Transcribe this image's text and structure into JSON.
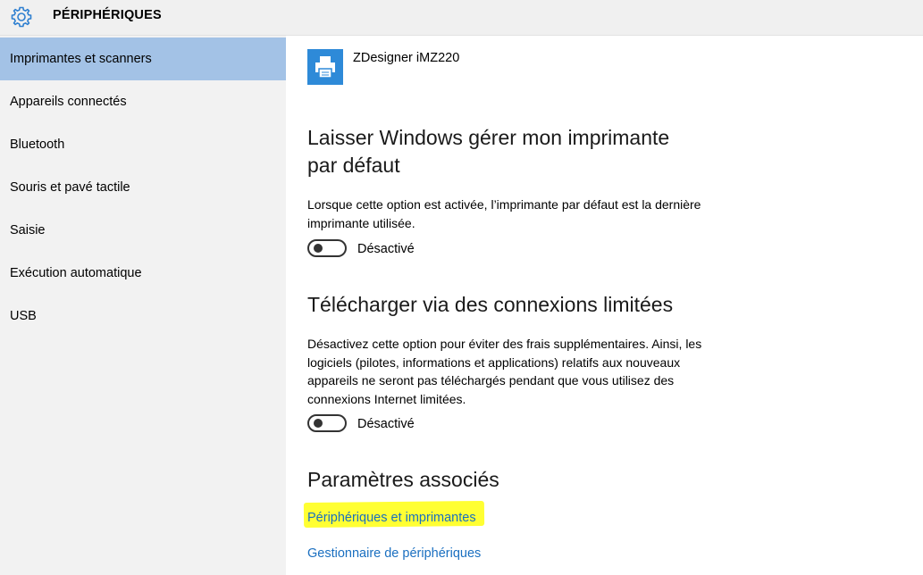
{
  "header": {
    "title": "PÉRIPHÉRIQUES",
    "icon": "gear-icon",
    "accent_color": "#2e8ad8"
  },
  "sidebar": {
    "selected_color": "#a3c2e6",
    "items": [
      {
        "label": "Imprimantes et scanners",
        "selected": true
      },
      {
        "label": "Appareils connectés",
        "selected": false
      },
      {
        "label": "Bluetooth",
        "selected": false
      },
      {
        "label": "Souris et pavé tactile",
        "selected": false
      },
      {
        "label": "Saisie",
        "selected": false
      },
      {
        "label": "Exécution automatique",
        "selected": false
      },
      {
        "label": "USB",
        "selected": false
      }
    ]
  },
  "main": {
    "printer": {
      "name": "ZDesigner iMZ220",
      "icon": "printer-icon"
    },
    "default_printer": {
      "heading": "Laisser Windows gérer mon imprimante par défaut",
      "description": "Lorsque cette option est activée, l’imprimante par défaut est la dernière imprimante utilisée.",
      "toggle_state": "Désactivé",
      "enabled": false
    },
    "metered": {
      "heading": "Télécharger via des connexions limitées",
      "description": "Désactivez cette option pour éviter des frais supplémentaires. Ainsi, les logiciels (pilotes, informations et applications) relatifs aux nouveaux appareils ne seront pas téléchargés pendant que vous utilisez des connexions Internet limitées.",
      "toggle_state": "Désactivé",
      "enabled": false
    },
    "related": {
      "heading": "Paramètres associés",
      "links": [
        {
          "label": "Périphériques et imprimantes",
          "highlighted": true
        },
        {
          "label": "Gestionnaire de périphériques",
          "highlighted": false
        }
      ],
      "link_color": "#1a6fc0",
      "highlight_color": "#ffff33"
    }
  }
}
